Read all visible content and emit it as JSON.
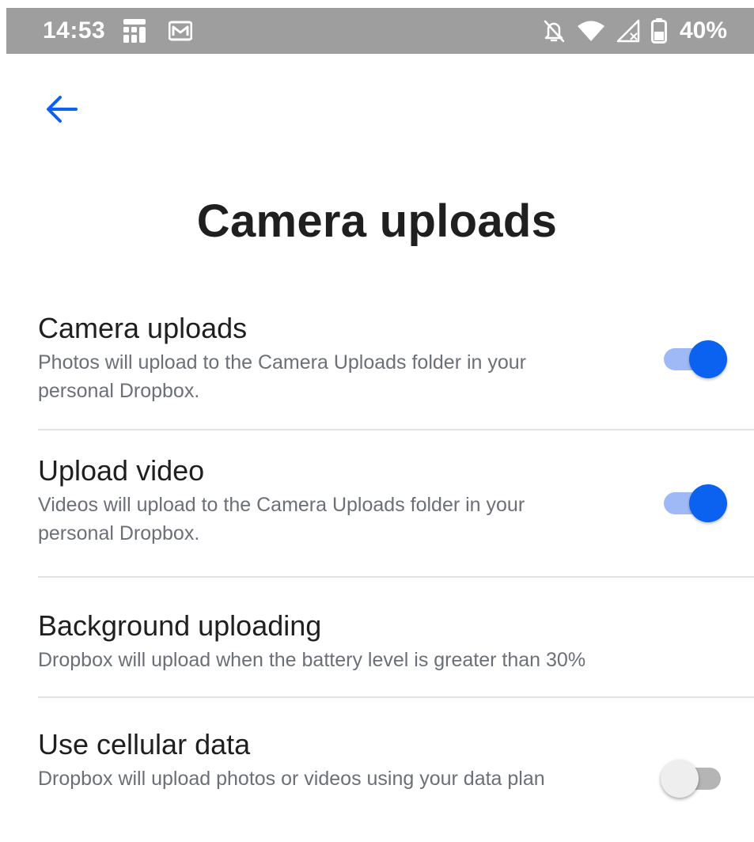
{
  "status_bar": {
    "time": "14:53",
    "battery": "40%",
    "icons": [
      "app-notification-icon",
      "gmail-icon",
      "do-not-disturb-icon",
      "wifi-icon",
      "signal-icon",
      "battery-icon"
    ]
  },
  "header": {
    "back_icon": "arrow-left-icon",
    "title": "Camera uploads"
  },
  "settings": [
    {
      "title": "Camera uploads",
      "description": "Photos will upload to the Camera Uploads folder in your personal Dropbox.",
      "enabled": true
    },
    {
      "title": "Upload video",
      "description": "Videos will upload to the Camera Uploads folder in your personal Dropbox.",
      "enabled": true
    },
    {
      "title": "Background uploading",
      "description": "Dropbox will upload when the battery level is greater than 30%",
      "enabled": null
    },
    {
      "title": "Use cellular data",
      "description": "Dropbox will upload photos or videos using your data plan",
      "enabled": false
    }
  ],
  "colors": {
    "accent": "#0b61f0",
    "accent_track": "#9fb8f6",
    "status_bar": "#9e9e9e",
    "secondary_text": "#6b6f76"
  }
}
